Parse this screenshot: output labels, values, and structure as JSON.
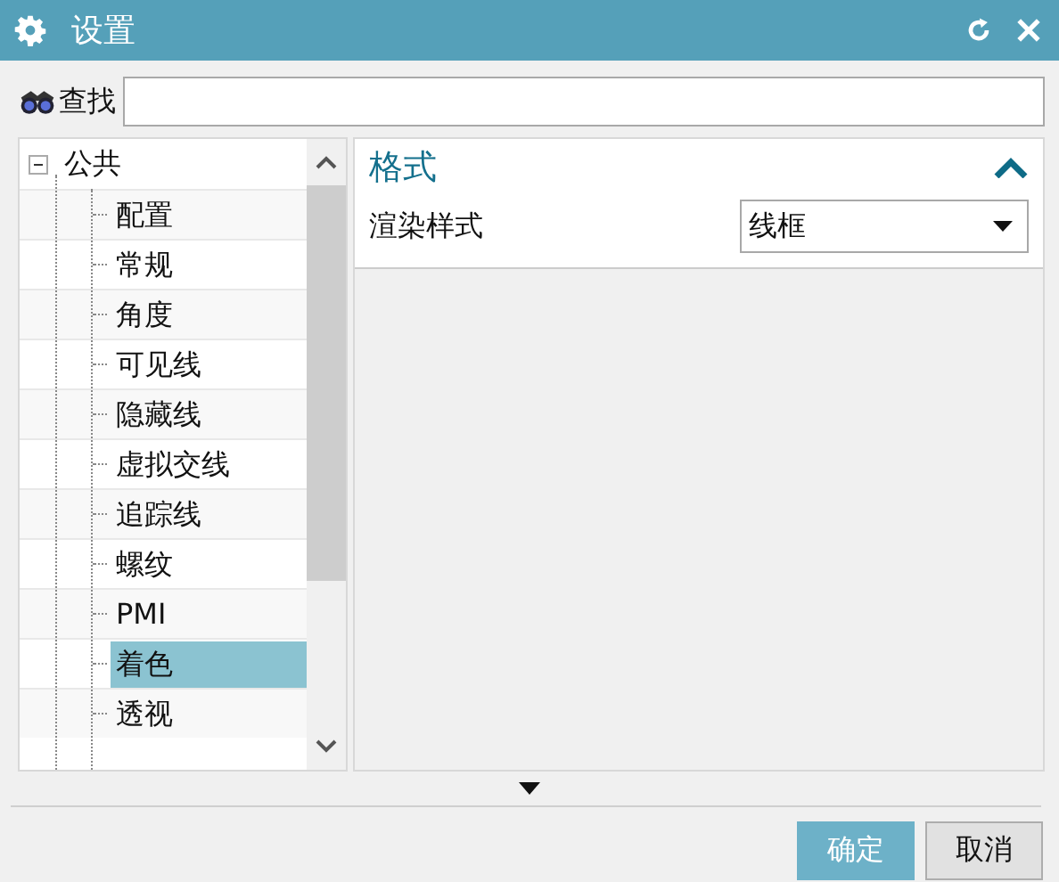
{
  "window": {
    "title": "设置"
  },
  "search": {
    "label": "查找"
  },
  "tree": [
    {
      "label": "公共",
      "expanded": true,
      "children": [
        {
          "label": "配置",
          "selected": false
        },
        {
          "label": "常规",
          "selected": false
        },
        {
          "label": "角度",
          "selected": false
        },
        {
          "label": "可见线",
          "selected": false
        },
        {
          "label": "隐藏线",
          "selected": false
        },
        {
          "label": "虚拟交线",
          "selected": false
        },
        {
          "label": "追踪线",
          "selected": false
        },
        {
          "label": "螺纹",
          "selected": false
        },
        {
          "label": "PMI",
          "selected": false
        },
        {
          "label": "着色",
          "selected": true
        },
        {
          "label": "透视",
          "selected": false
        }
      ]
    }
  ],
  "section": {
    "title": "格式",
    "expanded": true,
    "fields": [
      {
        "label": "渲染样式",
        "value": "线框"
      }
    ]
  },
  "buttons": [
    {
      "label": "确定",
      "kind": "primary"
    },
    {
      "label": "取消",
      "kind": "secondary"
    }
  ]
}
